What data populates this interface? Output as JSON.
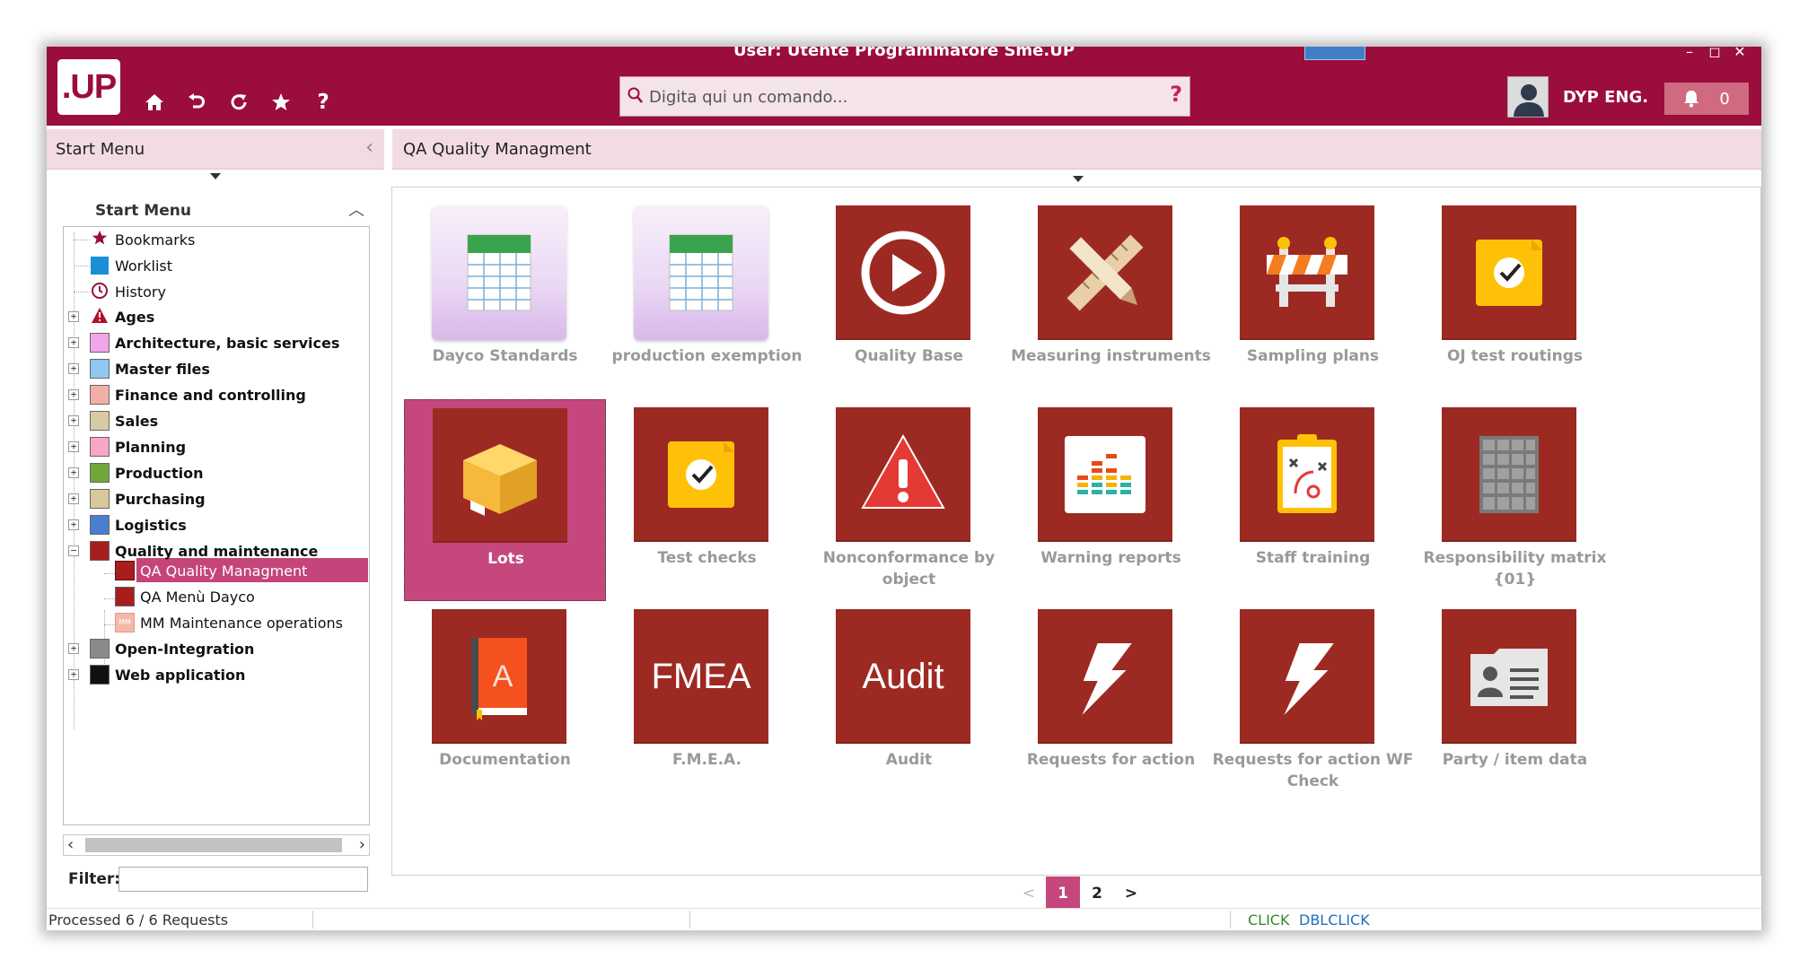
{
  "window": {
    "title": "User: Utente Programmatore Sme.UP",
    "controls": {
      "minimize": "–",
      "maximize": "◻",
      "close": "✕"
    }
  },
  "header": {
    "logo": ".UP",
    "toolbar": {
      "home_icon": "home-icon",
      "undo_icon": "undo-icon",
      "refresh_icon": "refresh-icon",
      "star_icon": "star-icon",
      "help": "?"
    },
    "command": {
      "placeholder": "Digita qui un comando...",
      "help": "?"
    },
    "user": {
      "name": "DYP ENG."
    },
    "notifications": {
      "count": "0"
    },
    "colors": {
      "brand": "#9b0d3c",
      "accent": "#c5477d",
      "tile": "#9d2a22"
    }
  },
  "left_panel": {
    "title": "Start Menu",
    "tree_title": "Start Menu",
    "tree": [
      {
        "label": "Bookmarks",
        "icon": "star-icon",
        "bold": false
      },
      {
        "label": "Worklist",
        "icon": "worklist-icon",
        "bold": false
      },
      {
        "label": "History",
        "icon": "clock-icon",
        "bold": false
      },
      {
        "label": "Ages",
        "icon": "warning-icon",
        "bold": true
      },
      {
        "label": "Architecture, basic services",
        "color": "#f0a6e8",
        "bold": true
      },
      {
        "label": "Master files",
        "color": "#8fc8f0",
        "bold": true
      },
      {
        "label": "Finance and controlling",
        "color": "#f0b0a8",
        "bold": true
      },
      {
        "label": "Sales",
        "color": "#d7cba2",
        "bold": true
      },
      {
        "label": "Planning",
        "color": "#f7a6c6",
        "bold": true
      },
      {
        "label": "Production",
        "color": "#6fa83a",
        "bold": true
      },
      {
        "label": "Purchasing",
        "color": "#d9c99a",
        "bold": true
      },
      {
        "label": "Logistics",
        "color": "#4a7fcf",
        "bold": true
      },
      {
        "label": "Quality and maintenance",
        "color": "#a81e1e",
        "bold": true
      },
      {
        "label": "QA Quality Managment",
        "color": "#a81e1e",
        "bold": false
      },
      {
        "label": "QA Menù Dayco",
        "color": "#a81e1e",
        "bold": false
      },
      {
        "label": "MM Maintenance operations",
        "color": "#f4b8a8",
        "badge": "MM",
        "bold": false
      },
      {
        "label": "Open-Integration",
        "color": "#8a8a8a",
        "bold": true
      },
      {
        "label": "Web application",
        "color": "#111111",
        "bold": true
      }
    ],
    "filter_label": "Filter:",
    "filter_value": ""
  },
  "main": {
    "title": "QA Quality Managment",
    "tiles": [
      {
        "label": "Dayco Standards",
        "icon": "spreadsheet-icon"
      },
      {
        "label": "production exemption",
        "icon": "spreadsheet-icon"
      },
      {
        "label": "Quality Base",
        "icon": "play-icon"
      },
      {
        "label": "Measuring instruments",
        "icon": "ruler-pencil-icon"
      },
      {
        "label": "Sampling plans",
        "icon": "barrier-icon"
      },
      {
        "label": "OJ test routings",
        "icon": "checklist-icon"
      },
      {
        "label": "Lots",
        "icon": "package-icon"
      },
      {
        "label": "Test checks",
        "icon": "checklist-icon"
      },
      {
        "label": "Nonconformance by object",
        "icon": "warning-icon"
      },
      {
        "label": "Warning reports",
        "icon": "equalizer-icon"
      },
      {
        "label": "Staff training",
        "icon": "clipboard-strategy-icon"
      },
      {
        "label": "Responsibility matrix {01}",
        "icon": "grid-icon"
      },
      {
        "label": "Documentation",
        "icon": "book-icon",
        "glyph": "A"
      },
      {
        "label": "F.M.E.A.",
        "icon": "text-icon",
        "glyph": "FMEA"
      },
      {
        "label": "Audit",
        "icon": "text-icon",
        "glyph": "Audit"
      },
      {
        "label": "Requests for action",
        "icon": "lightning-icon"
      },
      {
        "label": "Requests for action WF Check",
        "icon": "lightning-icon"
      },
      {
        "label": "Party / item data",
        "icon": "id-card-icon"
      }
    ],
    "pager": {
      "prev": "<",
      "pages": [
        "1",
        "2"
      ],
      "current": "1",
      "next": ">"
    }
  },
  "status": {
    "processed": "Processed 6 / 6 Requests",
    "click": "CLICK",
    "dblclick": "DBLCLICK"
  }
}
